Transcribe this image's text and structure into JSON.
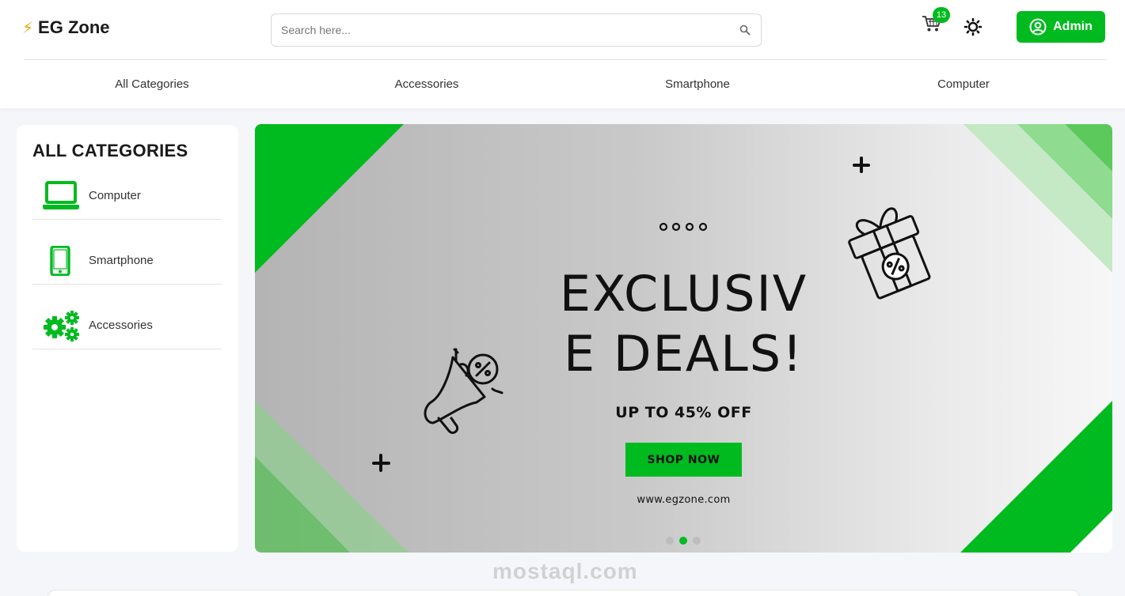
{
  "brand": {
    "name": "EG Zone",
    "bolt": "⚡",
    "accent": "#00bb1f"
  },
  "search": {
    "placeholder": "Search here...",
    "value": ""
  },
  "header": {
    "cart_count": "13",
    "admin_label": "Admin"
  },
  "nav": {
    "links": [
      "All Categories",
      "Accessories",
      "Smartphone",
      "Computer"
    ]
  },
  "sidebar": {
    "title": "ALL CATEGORIES",
    "items": [
      {
        "label": "Computer",
        "icon": "laptop-icon"
      },
      {
        "label": "Smartphone",
        "icon": "smartphone-icon"
      },
      {
        "label": "Accessories",
        "icon": "gears-icon"
      }
    ]
  },
  "banner": {
    "line1": "EXCLUSIV",
    "line2": "E DEALS!",
    "offer": "UP TO 45% OFF",
    "cta": "SHOP NOW",
    "url": "www.egzone.com",
    "slides": 3,
    "active_slide": 2
  },
  "watermark": "mostaql.com"
}
